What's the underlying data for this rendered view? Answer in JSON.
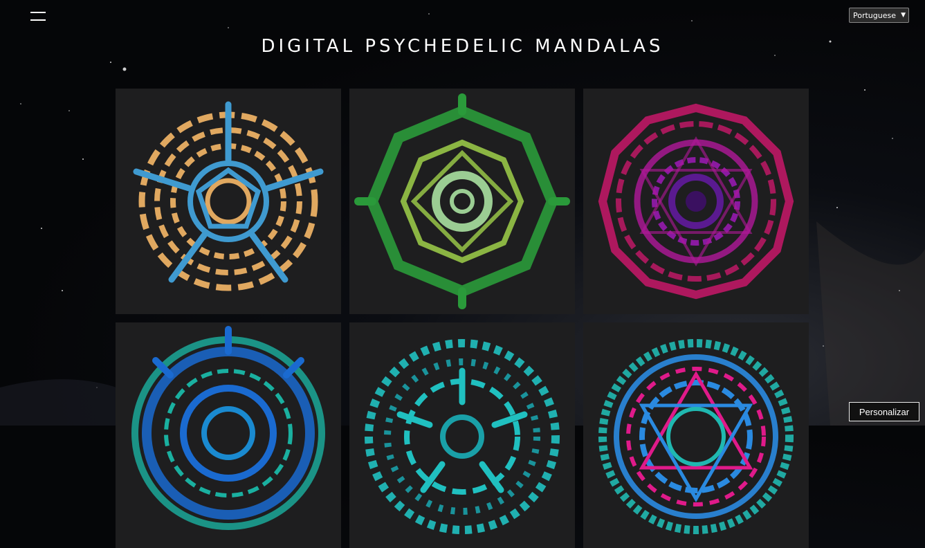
{
  "header": {
    "menu_icon": "hamburger-menu-icon",
    "language": {
      "selected": "Portuguese"
    },
    "title": "DIGITAL PSYCHEDELIC MANDALAS"
  },
  "gallery": {
    "items": [
      {
        "name": "mandala-gold-blue",
        "colors": [
          "#e0a860",
          "#3f9ad0"
        ]
      },
      {
        "name": "mandala-green",
        "colors": [
          "#2a9a3a",
          "#9fd04a",
          "#a8e0a0"
        ]
      },
      {
        "name": "mandala-magenta",
        "colors": [
          "#c8186a",
          "#8a1aa0",
          "#5a1a90"
        ]
      },
      {
        "name": "mandala-blue-teal",
        "colors": [
          "#1a6ad0",
          "#1ab0a0"
        ]
      },
      {
        "name": "mandala-cyan",
        "colors": [
          "#20c0c0",
          "#1aa0a8"
        ]
      },
      {
        "name": "mandala-teal-pink",
        "colors": [
          "#20b8b0",
          "#2a8ae0",
          "#e01a8a"
        ]
      }
    ]
  },
  "footer": {
    "personalize_label": "Personalizar"
  },
  "theme": {
    "background": "#050608",
    "tile_background": "#1e1e1f"
  }
}
